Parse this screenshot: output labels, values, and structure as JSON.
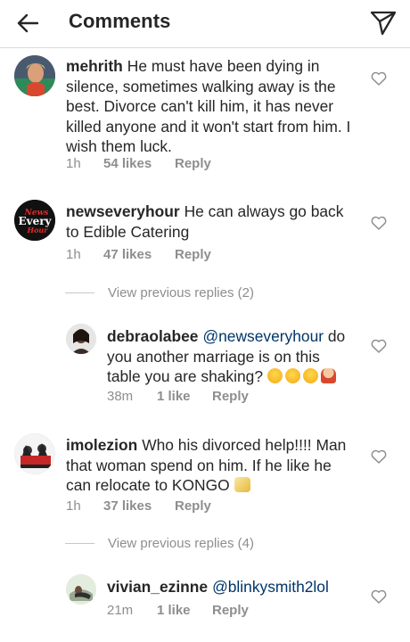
{
  "header": {
    "back_icon": "arrow-left-icon",
    "title": "Comments",
    "send_icon": "paper-plane-icon"
  },
  "comments": [
    {
      "username": "mehrith",
      "text": "He must have been dying in silence, sometimes walking away is the best. Divorce can't kill him, it has never killed anyone and it won't start from him. I wish them luck.",
      "time": "1h",
      "likes": "54 likes",
      "reply": "Reply"
    },
    {
      "username": "newseveryhour",
      "text": "He can always go back to Edible Catering",
      "time": "1h",
      "likes": "47 likes",
      "reply": "Reply",
      "avatar_logo_text": "News Every Hour",
      "view_previous": "View previous replies (2)",
      "replies": [
        {
          "username": "debraolabee",
          "mention": "@newseveryhour",
          "text": "do you another marriage is on this table you are shaking?",
          "emoji": [
            "grinning-sweat",
            "rofl",
            "grinning-sweat",
            "woman-gesturing-no"
          ],
          "time": "38m",
          "likes": "1 like",
          "reply": "Reply"
        }
      ]
    },
    {
      "username": "imolezion",
      "text": "Who his divorced help!!!! Man that woman spend on him. If he like he can relocate to KONGO",
      "emoji": [
        "clinking-glasses"
      ],
      "time": "1h",
      "likes": "37 likes",
      "reply": "Reply",
      "view_previous": "View previous replies (4)",
      "replies": [
        {
          "username": "vivian_ezinne",
          "mention": "@blinkysmith2lol",
          "time": "21m",
          "likes": "1 like",
          "reply": "Reply"
        }
      ]
    }
  ],
  "colors": {
    "text": "#262626",
    "secondary": "#8e8e8e",
    "mention": "#003569",
    "divider": "#dbdbdb"
  }
}
